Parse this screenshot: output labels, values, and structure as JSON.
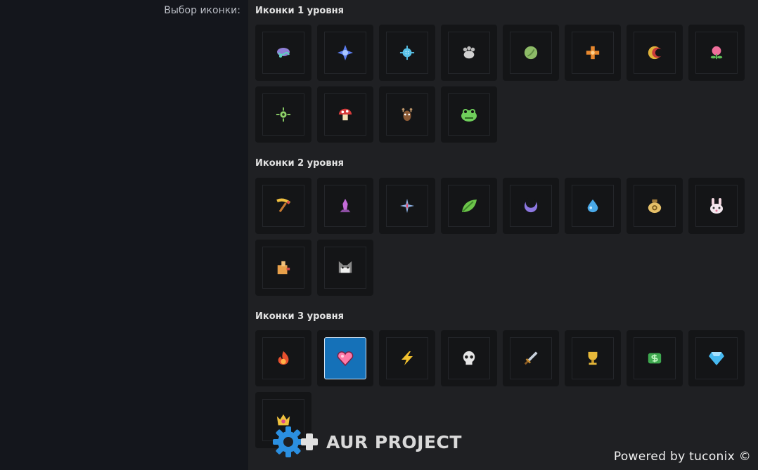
{
  "field": {
    "label": "Выбор иконки:"
  },
  "sections": [
    {
      "title": "Иконки 1 уровня",
      "icons": [
        "brain-icon",
        "blue-star-icon",
        "cyan-gear-icon",
        "grey-paw-icon",
        "green-orb-icon",
        "orange-cross-icon",
        "red-moon-icon",
        "pink-flower-icon",
        "green-sun-icon",
        "mushroom-icon",
        "deer-icon",
        "frog-icon"
      ]
    },
    {
      "title": "Иконки 2 уровня",
      "icons": [
        "pickaxe-icon",
        "crystal-icon",
        "sparkle-icon",
        "leaf-icon",
        "crescent-icon",
        "water-drop-icon",
        "coin-bag-icon",
        "bunny-icon",
        "box-icon",
        "cat-icon"
      ]
    },
    {
      "title": "Иконки 3 уровня",
      "icons": [
        "fire-icon",
        "heart-icon",
        "lightning-icon",
        "skull-icon",
        "sword-icon",
        "trophy-icon",
        "money-icon",
        "diamond-icon",
        "crown-icon"
      ],
      "selected_index": 1
    }
  ],
  "watermark": {
    "text": "AUR PROJECT"
  },
  "footer": {
    "powered": "Powered by tuconix ©"
  },
  "colors": {
    "accent": "#1571b8",
    "tile": "#141517",
    "left_pane": "#14161c",
    "right_pane": "#1f2023"
  }
}
